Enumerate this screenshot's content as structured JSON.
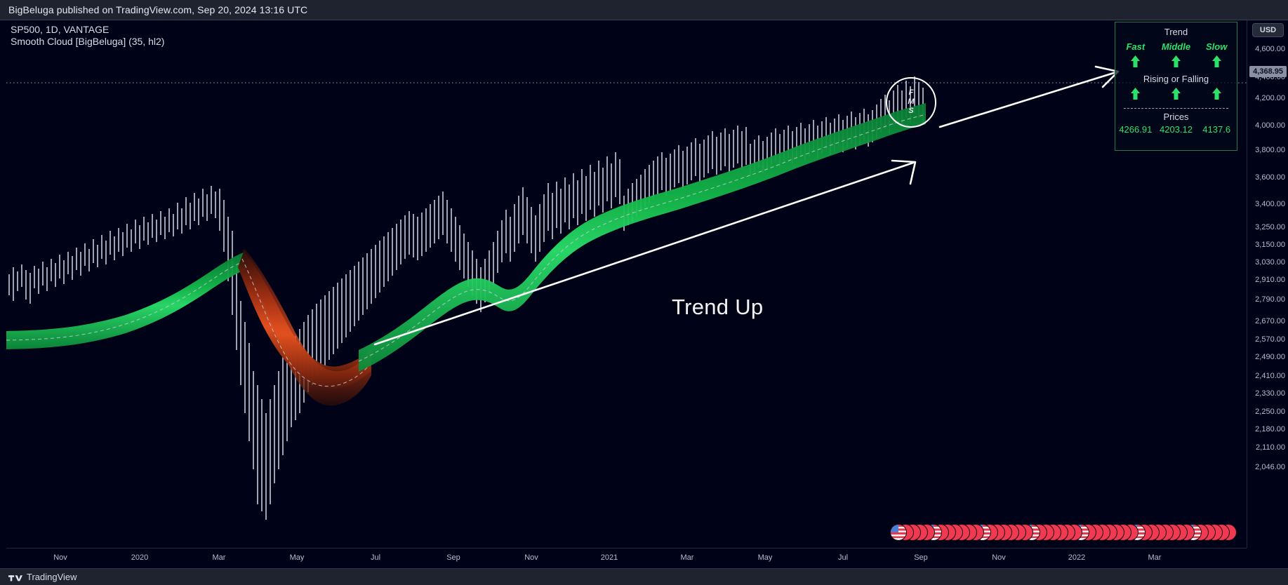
{
  "header": {
    "publisher_line": "BigBeluga published on TradingView.com, Sep 20, 2024 13:16 UTC"
  },
  "chart_legend": {
    "symbol_line": "SP500, 1D, VANTAGE",
    "indicator_line": "Smooth Cloud [BigBeluga] (35, hl2)"
  },
  "price_axis": {
    "currency_label": "USD",
    "current_price": "4,368.95",
    "ticks": [
      "4,600.00",
      "4,400.00",
      "4,200.00",
      "4,000.00",
      "3,800.00",
      "3,600.00",
      "3,400.00",
      "3,250.00",
      "3,150.00",
      "3,030.00",
      "2,910.00",
      "2,790.00",
      "2,670.00",
      "2,570.00",
      "2,490.00",
      "2,410.00",
      "2,330.00",
      "2,250.00",
      "2,180.00",
      "2,110.00",
      "2,046.00"
    ]
  },
  "time_axis": {
    "ticks": [
      "Nov",
      "2020",
      "Mar",
      "May",
      "Jul",
      "Sep",
      "Nov",
      "2021",
      "Mar",
      "May",
      "Jul",
      "Sep",
      "Nov",
      "2022",
      "Mar"
    ]
  },
  "indicator_panel": {
    "trend_title": "Trend",
    "columns": [
      "Fast",
      "Middle",
      "Slow"
    ],
    "trend_arrows": [
      "up",
      "up",
      "up"
    ],
    "rising_falling_title": "Rising or Falling",
    "rising_arrows": [
      "up",
      "up",
      "up"
    ],
    "prices_title": "Prices",
    "prices": [
      "4266.91",
      "4203.12",
      "4137.6"
    ],
    "accent_color": "#2ee06a",
    "border_color": "#1f7a45"
  },
  "annotations": {
    "circle_labels": [
      "F",
      "M",
      "S"
    ],
    "trend_up_text": "Trend Up"
  },
  "footer": {
    "logo_text": "TradingView"
  },
  "colors": {
    "background": "#000317",
    "chrome": "#1f2330",
    "bull_cloud": "#17c24f",
    "bear_cloud": "#e04a1e",
    "candle": "#d9dbe6",
    "annotation": "#ffffff"
  },
  "chart_data": {
    "type": "line",
    "title": "SP500 1D — Smooth Cloud [BigBeluga] (35, hl2)",
    "xlabel": "",
    "ylabel": "USD",
    "ylim": [
      2046,
      4700
    ],
    "grid": false,
    "legend_position": "top-left",
    "x_ticks": [
      "Nov",
      "2020",
      "Mar",
      "May",
      "Jul",
      "Sep",
      "Nov",
      "2021",
      "Mar",
      "May",
      "Jul",
      "Sep",
      "Nov",
      "2022",
      "Mar"
    ],
    "y_ticks": [
      4600,
      4400,
      4200,
      4000,
      3800,
      3600,
      3400,
      3250,
      3150,
      3030,
      2910,
      2790,
      2670,
      2570,
      2490,
      2410,
      2330,
      2250,
      2180,
      2110,
      2046
    ],
    "series": [
      {
        "name": "Price (hl2)",
        "x": [
          "2019-10",
          "2019-12",
          "2020-01",
          "2020-02",
          "2020-03",
          "2020-04",
          "2020-05",
          "2020-06",
          "2020-07",
          "2020-08",
          "2020-09",
          "2020-10",
          "2020-11",
          "2020-12",
          "2021-01",
          "2021-02",
          "2021-03",
          "2021-04",
          "2021-05",
          "2021-06",
          "2021-07"
        ],
        "values": [
          2960,
          3100,
          3230,
          3380,
          2380,
          2470,
          2850,
          3080,
          3200,
          3350,
          3380,
          3420,
          3580,
          3700,
          3780,
          3880,
          3970,
          4150,
          4200,
          4280,
          4400
        ]
      },
      {
        "name": "Fast cloud band",
        "values": [
          4266.91
        ]
      },
      {
        "name": "Middle cloud band",
        "values": [
          4203.12
        ]
      },
      {
        "name": "Slow cloud band",
        "values": [
          4137.6
        ]
      }
    ],
    "annotations": [
      {
        "text": "Trend Up",
        "type": "text"
      },
      {
        "text": "F M S",
        "type": "circle-callout"
      },
      {
        "text": "4,368.95",
        "type": "price-line"
      }
    ]
  }
}
